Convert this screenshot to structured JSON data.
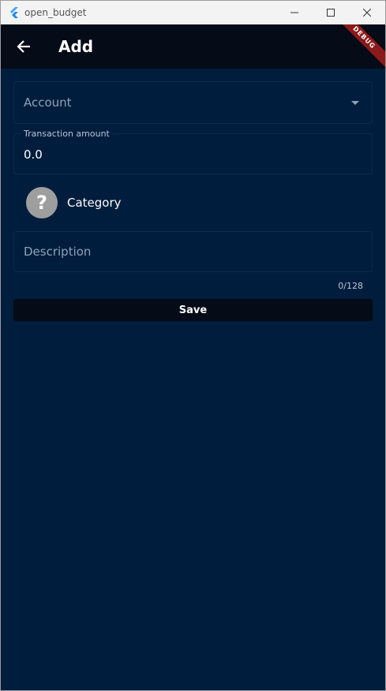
{
  "window": {
    "title": "open_budget",
    "icon": "flutter-logo-icon",
    "controls": {
      "minimize": "—",
      "maximize": "☐",
      "close": "✕"
    }
  },
  "appbar": {
    "title": "Add",
    "back_icon": "arrow-left-icon",
    "debug_label": "DEBUG"
  },
  "form": {
    "account_placeholder": "Account",
    "amount_label": "Transaction amount",
    "amount_value": "0.0",
    "category_label": "Category",
    "category_icon_glyph": "?",
    "description_placeholder": "Description",
    "description_counter": "0/128",
    "save_label": "Save"
  },
  "colors": {
    "background": "#001d3d",
    "appbar": "#050b17",
    "debug_ribbon": "#8b1a1a"
  }
}
